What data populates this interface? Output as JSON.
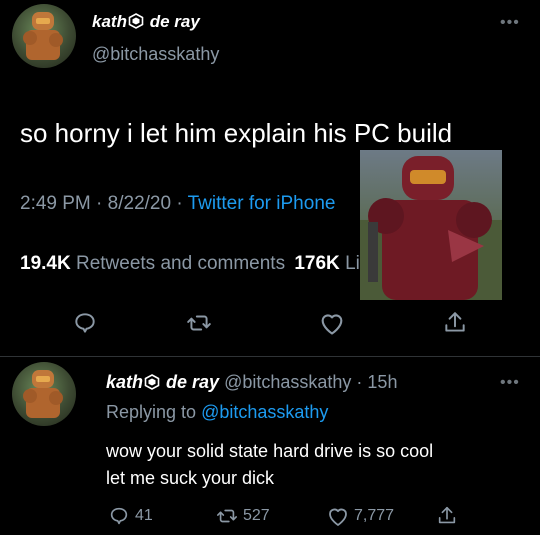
{
  "main_tweet": {
    "display_name": "kath",
    "display_name_suffix": "de ray",
    "handle": "@bitchasskathy",
    "text": "so horny i let him explain his PC build",
    "time": "2:49 PM",
    "date": "8/22/20",
    "source": "Twitter for iPhone",
    "retweets_count": "19.4K",
    "retweets_label": "Retweets and comments",
    "likes_count": "176K",
    "likes_label": "Likes"
  },
  "reply_tweet": {
    "display_name": "kath",
    "display_name_suffix": "de ray",
    "handle": "@bitchasskathy",
    "age": "15h",
    "replying_label": "Replying to",
    "replying_to": "@bitchasskathy",
    "text_line1": "wow your solid state hard drive is so cool",
    "text_line2": "let me suck your dick",
    "reply_count": "41",
    "retweet_count": "527",
    "like_count": "7,777"
  },
  "colors": {
    "background": "#000000",
    "text": "#e7e9ea",
    "muted": "#8b98a5",
    "link": "#1d9bf0",
    "divider": "#2f3336"
  }
}
